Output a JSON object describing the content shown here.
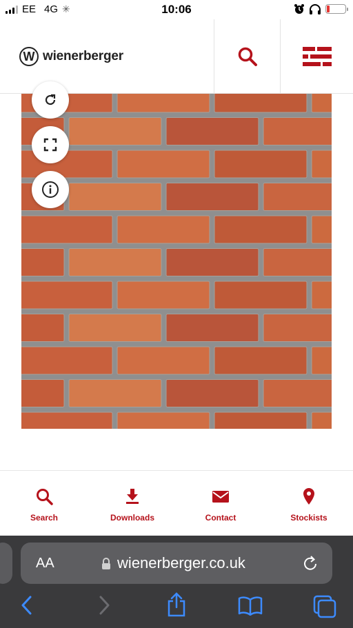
{
  "status_bar": {
    "carrier": "EE",
    "network": "4G",
    "time": "10:06",
    "battery_level": 0.1
  },
  "header": {
    "brand": "wienerberger",
    "logo_letter": "W",
    "accent": "#b5121b"
  },
  "product_viewer": {
    "buttons": [
      "rotate",
      "fullscreen",
      "info"
    ]
  },
  "bottom_nav": {
    "items": [
      {
        "label": "Search",
        "icon": "search-icon"
      },
      {
        "label": "Downloads",
        "icon": "download-icon"
      },
      {
        "label": "Contact",
        "icon": "mail-icon"
      },
      {
        "label": "Stockists",
        "icon": "location-pin-icon"
      }
    ]
  },
  "browser": {
    "aa_label": "AA",
    "url": "wienerberger.co.uk"
  }
}
